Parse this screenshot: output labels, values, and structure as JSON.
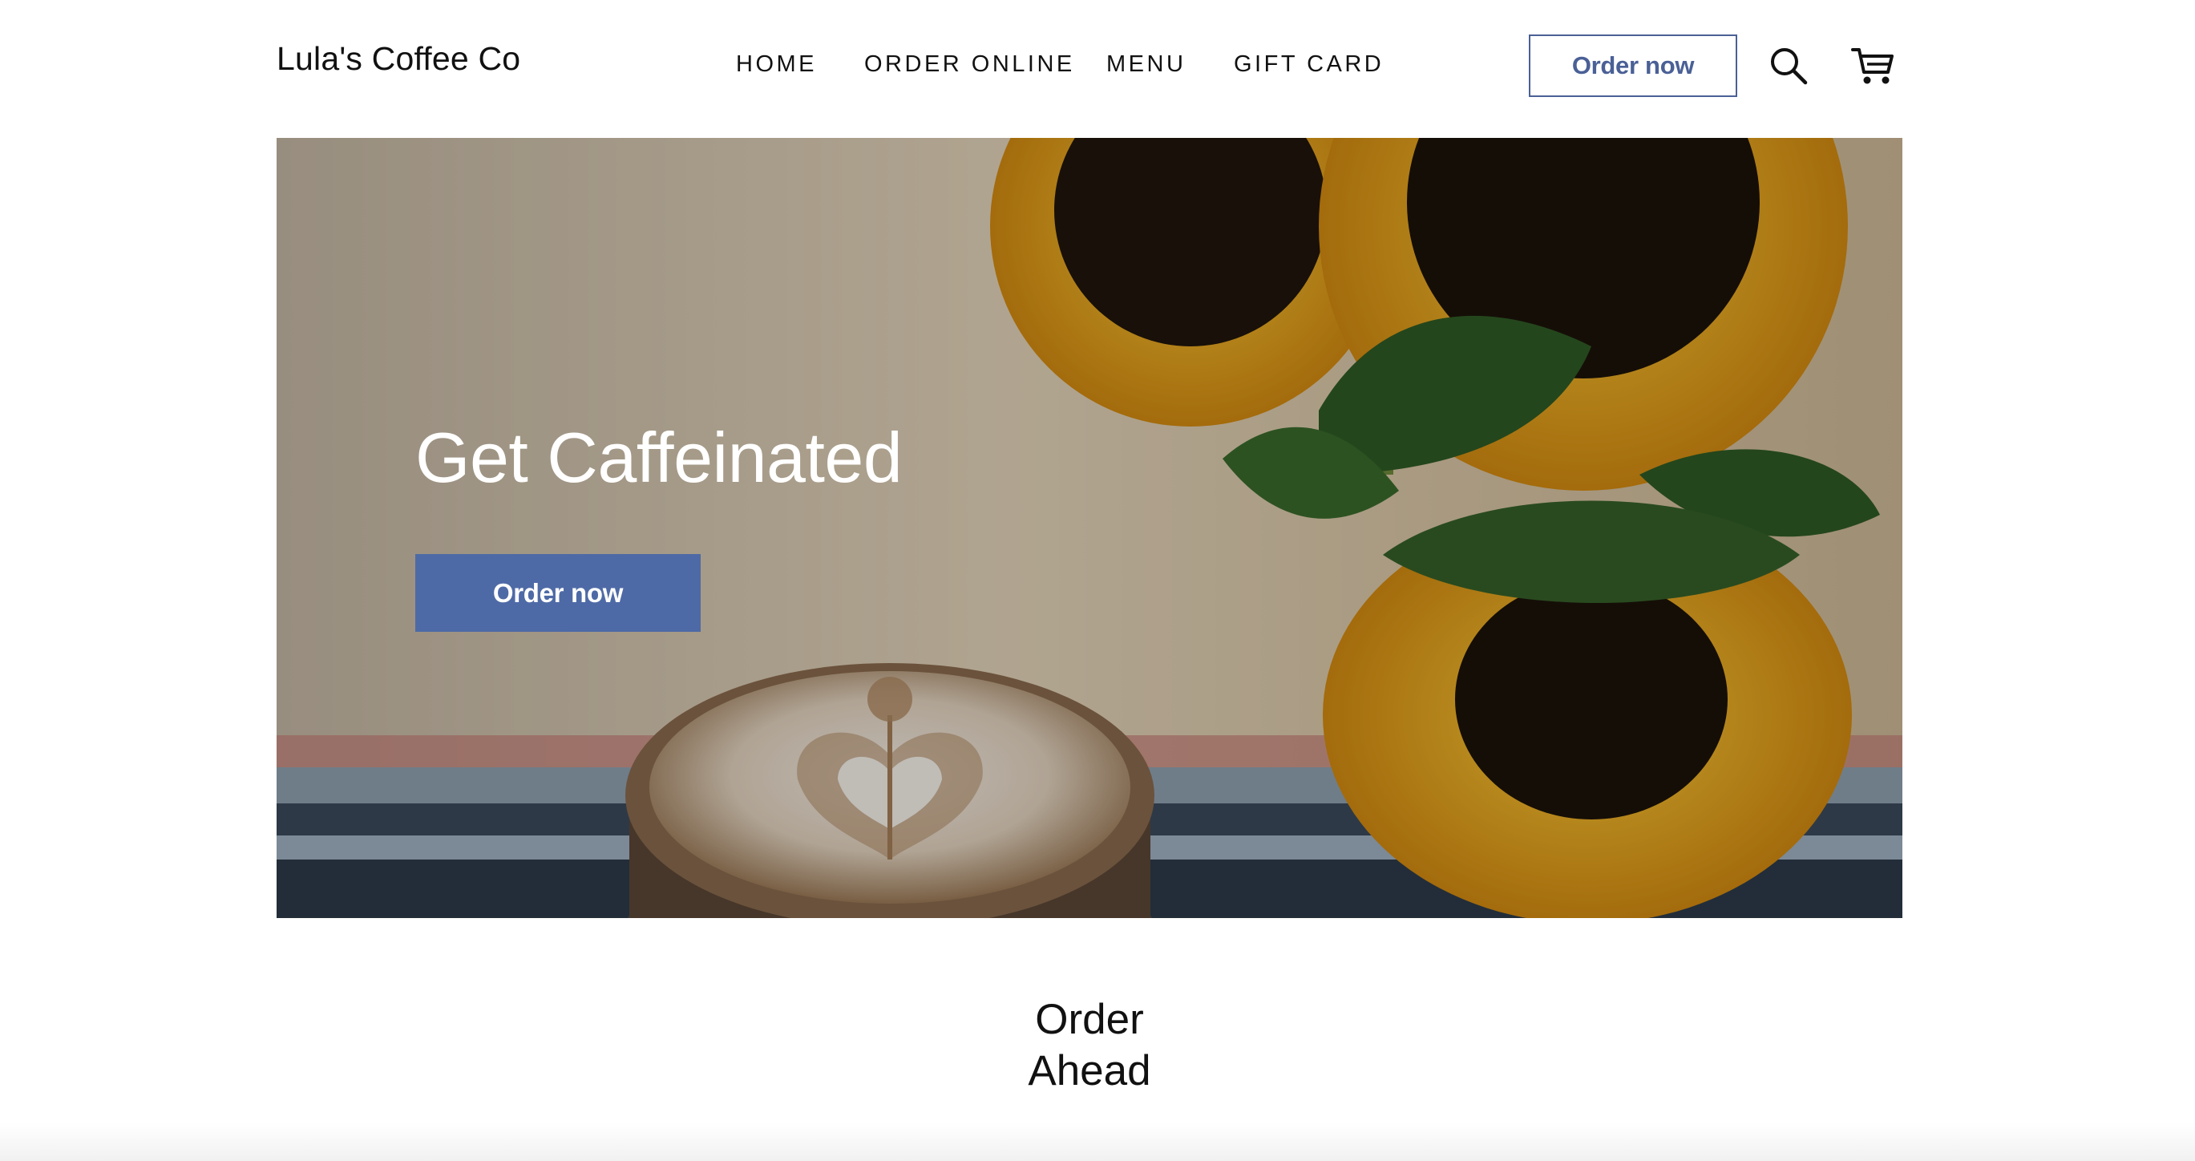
{
  "header": {
    "brand": "Lula's Coffee Co",
    "nav": [
      {
        "label": "HOME"
      },
      {
        "label": "ORDER ONLINE"
      },
      {
        "label": "MENU"
      },
      {
        "label": "GIFT CARD"
      }
    ],
    "order_button": "Order now",
    "icons": [
      "search-icon",
      "cart-icon"
    ]
  },
  "hero": {
    "title": "Get Caffeinated",
    "button": "Order now",
    "image": "latte-art-and-sunflowers-photo"
  },
  "section": {
    "title_line1": "Order",
    "title_line2": "Ahead"
  },
  "colors": {
    "accent": "#4e6aa6",
    "outline": "#4a6096",
    "text": "#111111",
    "background": "#ffffff"
  }
}
